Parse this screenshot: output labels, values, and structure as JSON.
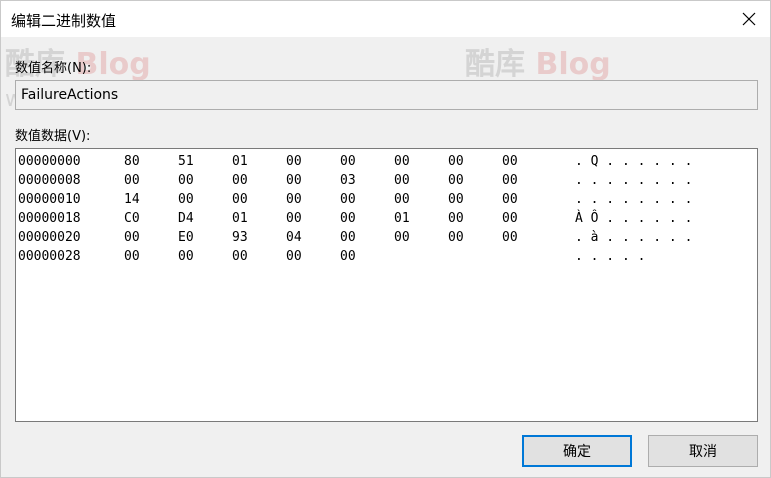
{
  "window": {
    "title": "编辑二进制数值",
    "close_glyph": "✕"
  },
  "value_name": {
    "label": "数值名称(N):",
    "value": "FailureActions"
  },
  "value_data": {
    "label": "数值数据(V):",
    "rows": [
      {
        "offset": "00000000",
        "bytes": [
          "80",
          "51",
          "01",
          "00",
          "00",
          "00",
          "00",
          "00"
        ],
        "ascii": ". Q . . . . . ."
      },
      {
        "offset": "00000008",
        "bytes": [
          "00",
          "00",
          "00",
          "00",
          "03",
          "00",
          "00",
          "00"
        ],
        "ascii": ". . . . . . . ."
      },
      {
        "offset": "00000010",
        "bytes": [
          "14",
          "00",
          "00",
          "00",
          "00",
          "00",
          "00",
          "00"
        ],
        "ascii": ". . . . . . . ."
      },
      {
        "offset": "00000018",
        "bytes": [
          "C0",
          "D4",
          "01",
          "00",
          "00",
          "01",
          "00",
          "00"
        ],
        "ascii": "À Ô . . . . . ."
      },
      {
        "offset": "00000020",
        "bytes": [
          "00",
          "E0",
          "93",
          "04",
          "00",
          "00",
          "00",
          "00"
        ],
        "ascii": ". à . . . . . ."
      },
      {
        "offset": "00000028",
        "bytes": [
          "00",
          "00",
          "00",
          "00",
          "00"
        ],
        "ascii": ". . . . ."
      }
    ]
  },
  "buttons": {
    "ok": "确定",
    "cancel": "取消"
  },
  "watermark": {
    "logo_cn": "酷库",
    "logo_en": "Blog",
    "url": "www.zxki.cn"
  }
}
